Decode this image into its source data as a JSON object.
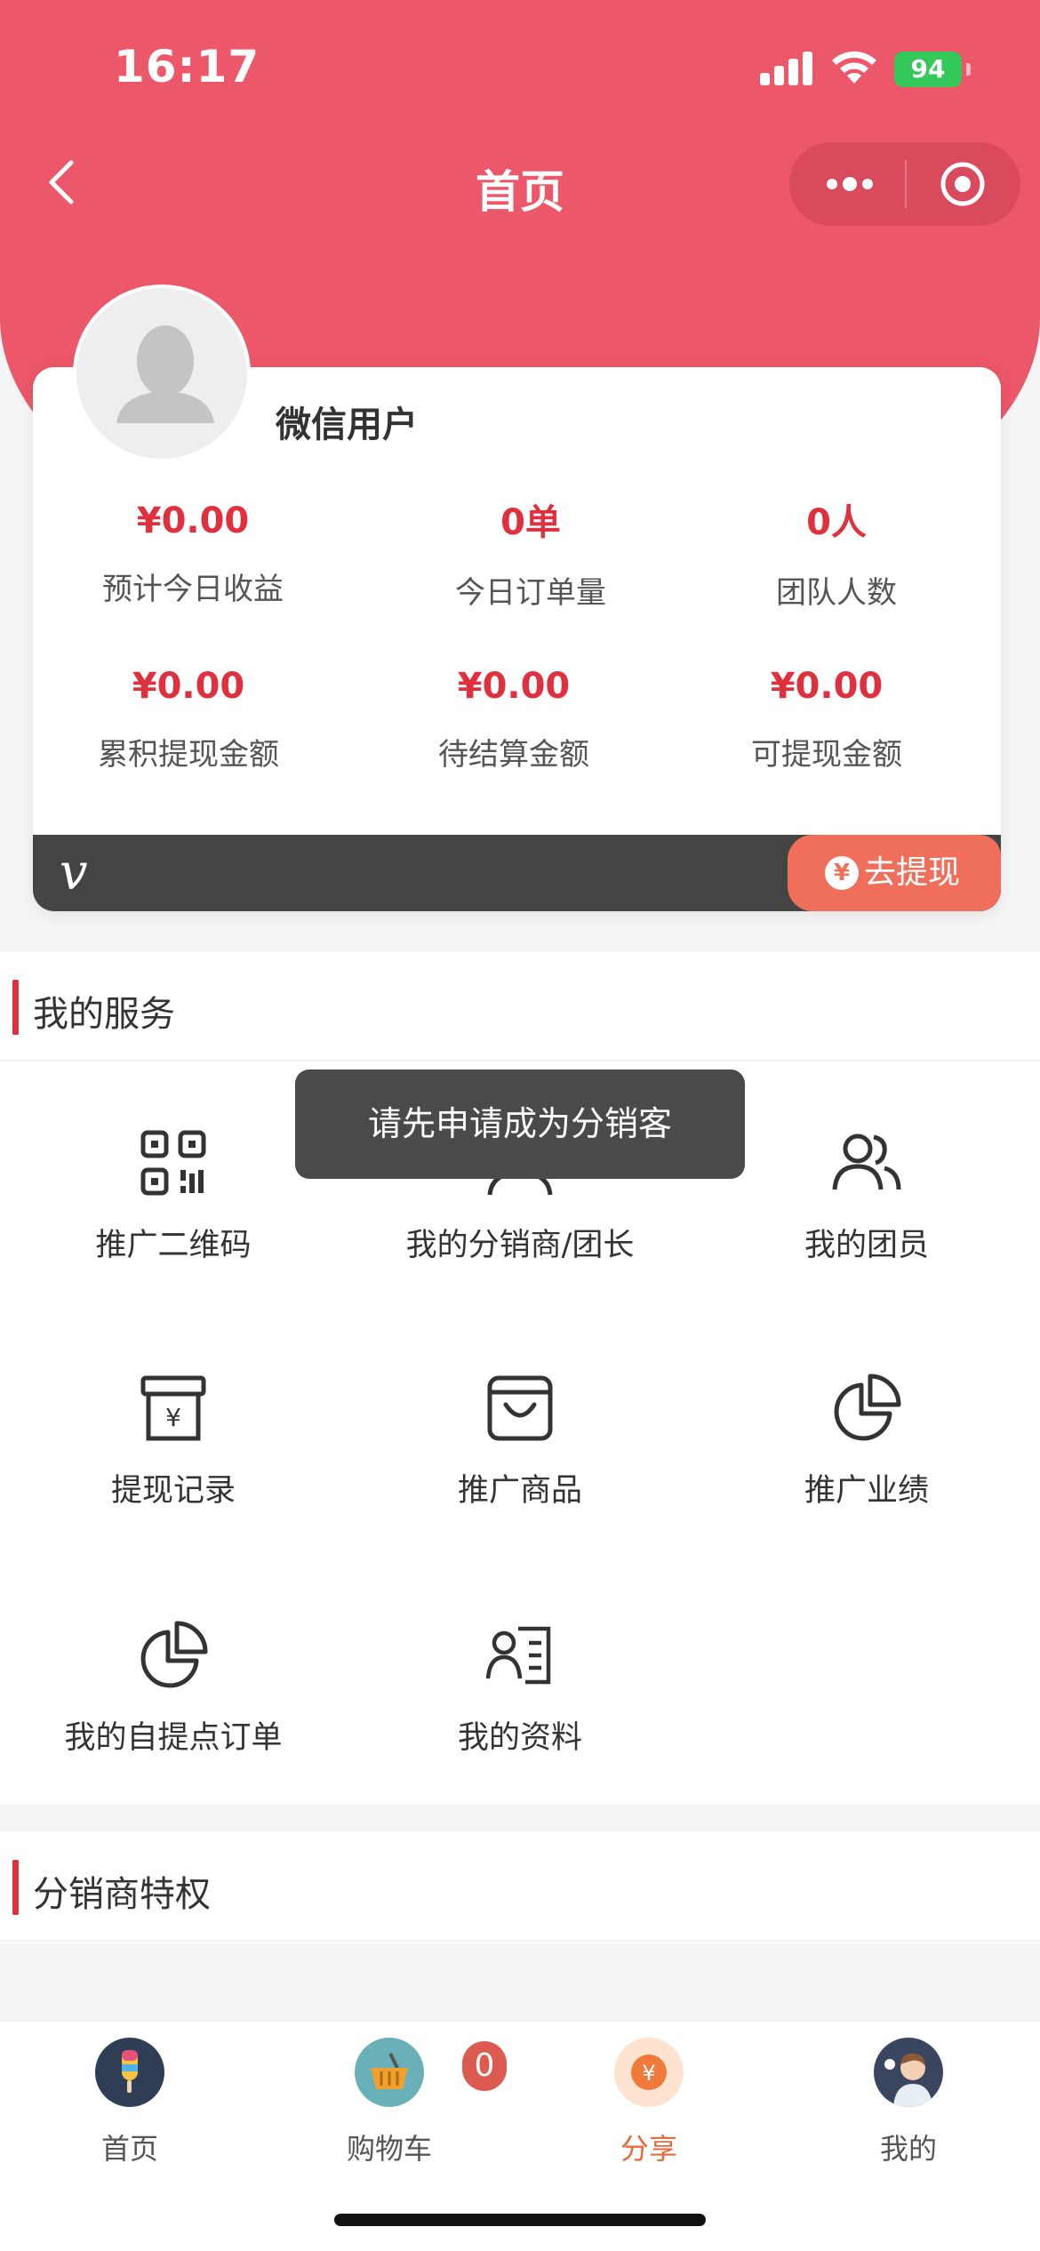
{
  "status_bar": {
    "time": "16:17",
    "battery": "94"
  },
  "nav": {
    "title": "首页"
  },
  "profile": {
    "username": "微信用户",
    "stats": [
      {
        "value": "¥0.00",
        "label": "预计今日收益"
      },
      {
        "value": "0单",
        "label": "今日订单量"
      },
      {
        "value": "0人",
        "label": "团队人数"
      },
      {
        "value": "¥0.00",
        "label": "累积提现金额"
      },
      {
        "value": "¥0.00",
        "label": "待结算金额"
      },
      {
        "value": "¥0.00",
        "label": "可提现金额"
      }
    ],
    "vip_mark": "v",
    "withdraw_label": "去提现",
    "withdraw_icon": "¥"
  },
  "services": {
    "title": "我的服务",
    "items": [
      {
        "label": "推广二维码",
        "icon": "qrcode-icon"
      },
      {
        "label": "我的分销商/团长",
        "icon": "distributor-icon"
      },
      {
        "label": "我的团员",
        "icon": "members-icon"
      },
      {
        "label": "提现记录",
        "icon": "withdraw-record-icon"
      },
      {
        "label": "推广商品",
        "icon": "shopping-bag-icon"
      },
      {
        "label": "推广业绩",
        "icon": "pie-chart-icon"
      },
      {
        "label": "我的自提点订单",
        "icon": "pie-chart-icon"
      },
      {
        "label": "我的资料",
        "icon": "profile-card-icon"
      }
    ]
  },
  "toast": {
    "text": "请先申请成为分销客"
  },
  "privileges": {
    "title": "分销商特权"
  },
  "tabbar": {
    "items": [
      {
        "label": "首页",
        "icon": "home-popsicle-icon"
      },
      {
        "label": "购物车",
        "icon": "cart-basket-icon"
      },
      {
        "label": "分享",
        "icon": "share-coin-icon"
      },
      {
        "label": "我的",
        "icon": "user-avatar-icon"
      }
    ],
    "cart_badge": "0",
    "active_index": 2
  },
  "colors": {
    "header": "#ec5769",
    "accent_red": "#e0303d",
    "withdraw_button": "#ef6f5b",
    "active_tab": "#e86a3c"
  }
}
